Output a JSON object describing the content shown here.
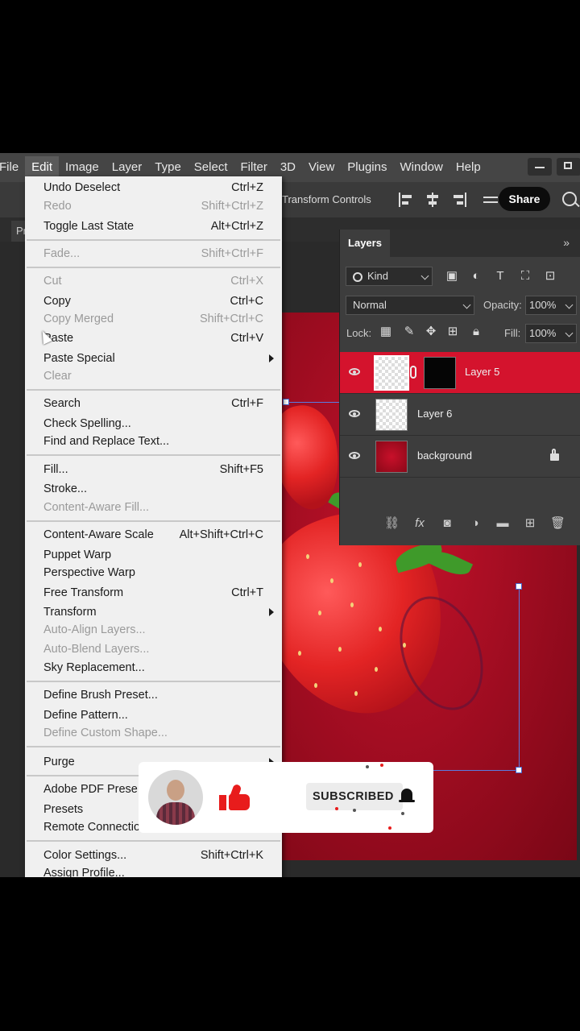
{
  "menubar": {
    "items": [
      "File",
      "Edit",
      "Image",
      "Layer",
      "Type",
      "Select",
      "Filter",
      "3D",
      "View",
      "Plugins",
      "Window",
      "Help"
    ],
    "active": "Edit"
  },
  "options_bar": {
    "transform_controls_label": "Transform Controls",
    "share_label": "Share"
  },
  "doc_tab": {
    "label": "Pr"
  },
  "edit_menu": {
    "items": [
      {
        "label": "Undo Deselect",
        "shortcut": "Ctrl+Z",
        "enabled": true
      },
      {
        "label": "Redo",
        "shortcut": "Shift+Ctrl+Z",
        "enabled": false
      },
      {
        "label": "Toggle Last State",
        "shortcut": "Alt+Ctrl+Z",
        "enabled": true
      },
      {
        "label": "Fade...",
        "shortcut": "Shift+Ctrl+F",
        "enabled": false
      },
      {
        "label": "Cut",
        "shortcut": "Ctrl+X",
        "enabled": false
      },
      {
        "label": "Copy",
        "shortcut": "Ctrl+C",
        "enabled": true
      },
      {
        "label": "Copy Merged",
        "shortcut": "Shift+Ctrl+C",
        "enabled": false
      },
      {
        "label": "Paste",
        "shortcut": "Ctrl+V",
        "enabled": true
      },
      {
        "label": "Paste Special",
        "shortcut": "",
        "enabled": true,
        "submenu": true
      },
      {
        "label": "Clear",
        "shortcut": "",
        "enabled": false
      },
      {
        "label": "Search",
        "shortcut": "Ctrl+F",
        "enabled": true
      },
      {
        "label": "Check Spelling...",
        "shortcut": "",
        "enabled": true
      },
      {
        "label": "Find and Replace Text...",
        "shortcut": "",
        "enabled": true
      },
      {
        "label": "Fill...",
        "shortcut": "Shift+F5",
        "enabled": true
      },
      {
        "label": "Stroke...",
        "shortcut": "",
        "enabled": true
      },
      {
        "label": "Content-Aware Fill...",
        "shortcut": "",
        "enabled": false
      },
      {
        "label": "Content-Aware Scale",
        "shortcut": "Alt+Shift+Ctrl+C",
        "enabled": true
      },
      {
        "label": "Puppet Warp",
        "shortcut": "",
        "enabled": true
      },
      {
        "label": "Perspective Warp",
        "shortcut": "",
        "enabled": true
      },
      {
        "label": "Free Transform",
        "shortcut": "Ctrl+T",
        "enabled": true
      },
      {
        "label": "Transform",
        "shortcut": "",
        "enabled": true,
        "submenu": true
      },
      {
        "label": "Auto-Align Layers...",
        "shortcut": "",
        "enabled": false
      },
      {
        "label": "Auto-Blend Layers...",
        "shortcut": "",
        "enabled": false
      },
      {
        "label": "Sky Replacement...",
        "shortcut": "",
        "enabled": true
      },
      {
        "label": "Define Brush Preset...",
        "shortcut": "",
        "enabled": true
      },
      {
        "label": "Define Pattern...",
        "shortcut": "",
        "enabled": true
      },
      {
        "label": "Define Custom Shape...",
        "shortcut": "",
        "enabled": false
      },
      {
        "label": "Purge",
        "shortcut": "",
        "enabled": true,
        "submenu": true
      },
      {
        "label": "Adobe PDF Prese",
        "shortcut": "",
        "enabled": true
      },
      {
        "label": "Presets",
        "shortcut": "",
        "enabled": true
      },
      {
        "label": "Remote Connectio",
        "shortcut": "",
        "enabled": true
      },
      {
        "label": "Color Settings...",
        "shortcut": "Shift+Ctrl+K",
        "enabled": true
      },
      {
        "label": "Assign Profile...",
        "shortcut": "",
        "enabled": true
      }
    ]
  },
  "layers_panel": {
    "tab_label": "Layers",
    "more_label": "»",
    "filter_kind": "Kind",
    "blend_mode": "Normal",
    "opacity_label": "Opacity:",
    "opacity_value": "100%",
    "lock_label": "Lock:",
    "fill_label": "Fill:",
    "fill_value": "100%",
    "layers": [
      {
        "name": "Layer 5",
        "selected": true,
        "has_mask": true
      },
      {
        "name": "Layer 6",
        "selected": false
      },
      {
        "name": "background",
        "selected": false,
        "locked": true
      }
    ]
  },
  "subscribe_overlay": {
    "button_label": "SUBSCRIBED",
    "accent_color": "#e81c1c"
  },
  "colors": {
    "menubar_bg": "#454545",
    "canvas_red": "#c4122a",
    "selected_layer": "#d4132d",
    "menu_bg": "#f0f0f0"
  }
}
